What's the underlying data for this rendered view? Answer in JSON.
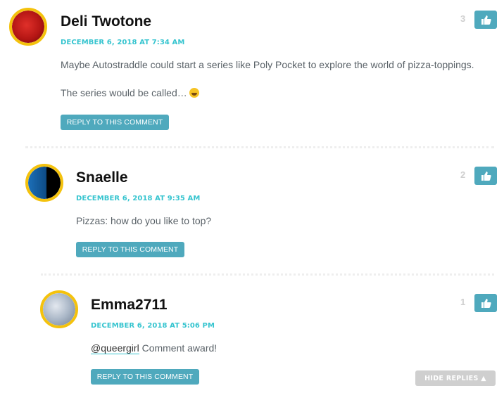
{
  "comments": [
    {
      "author": "Deli Twotone",
      "date": "DECEMBER 6, 2018 AT 7:34 AM",
      "paragraphs": [
        "Maybe Autostraddle could start a series like Poly Pocket to explore the world of pizza-toppings.",
        "The series would be called…"
      ],
      "emoji": "grinning-face",
      "votes": "3",
      "reply_label": "REPLY TO THIS COMMENT",
      "like_icon": "thumbs-up-icon"
    },
    {
      "author": "Snaelle",
      "date": "DECEMBER 6, 2018 AT 9:35 AM",
      "paragraphs": [
        "Pizzas: how do you like to top?"
      ],
      "votes": "2",
      "reply_label": "REPLY TO THIS COMMENT",
      "like_icon": "thumbs-up-icon"
    },
    {
      "author": "Emma2711",
      "date": "DECEMBER 6, 2018 AT 5:06 PM",
      "mention": "@queergirl",
      "text": " Comment award!",
      "votes": "1",
      "reply_label": "REPLY TO THIS COMMENT",
      "like_icon": "thumbs-up-icon"
    }
  ],
  "hide_replies_label": "HIDE REPLIES ▲",
  "colors": {
    "accent": "#4fa9bd",
    "date": "#35c4cf",
    "avatar_ring": "#f4c20d",
    "muted_button": "#cfcfcf"
  }
}
